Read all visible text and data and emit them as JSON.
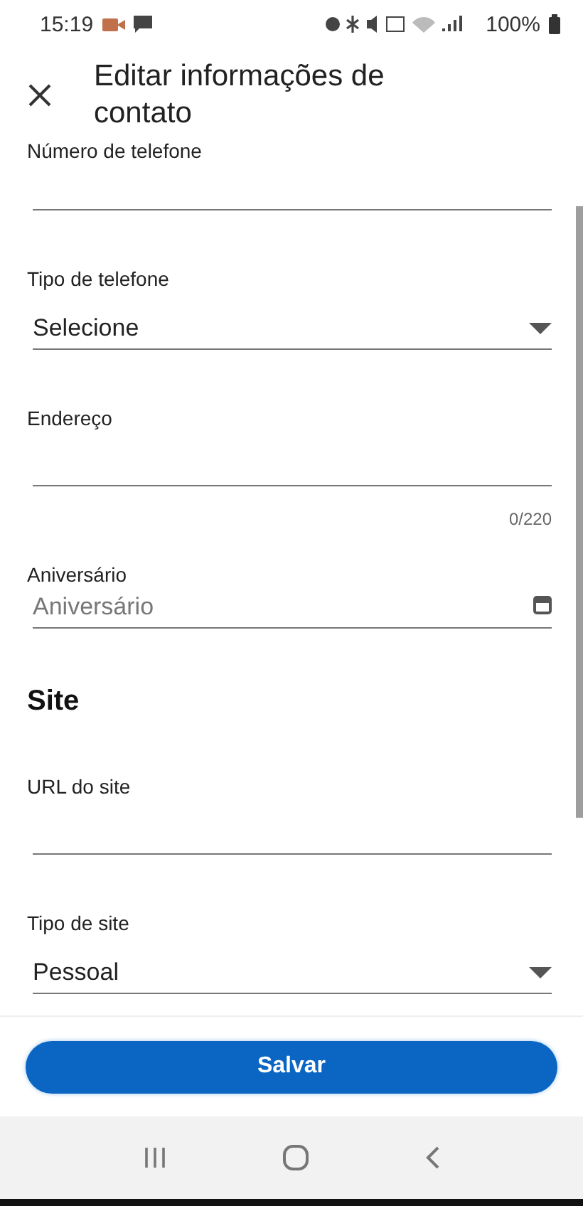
{
  "status_bar": {
    "time": "15:19",
    "battery": "100%"
  },
  "header": {
    "title": "Editar informações de contato"
  },
  "fields": [
    {
      "kind": "text",
      "label": "Número de telefone"
    },
    {
      "kind": "select",
      "label": "Tipo de telefone",
      "value": "Selecione"
    },
    {
      "kind": "text",
      "label": "Endereço",
      "counter": "0/220"
    },
    {
      "kind": "date",
      "label": "Aniversário",
      "placeholder": "Aniversário"
    },
    {
      "kind": "heading",
      "label": "Site"
    },
    {
      "kind": "text",
      "label": "URL do site"
    },
    {
      "kind": "select",
      "label": "Tipo de site",
      "value": "Pessoal"
    }
  ],
  "footer": {
    "button": "Salvar"
  }
}
